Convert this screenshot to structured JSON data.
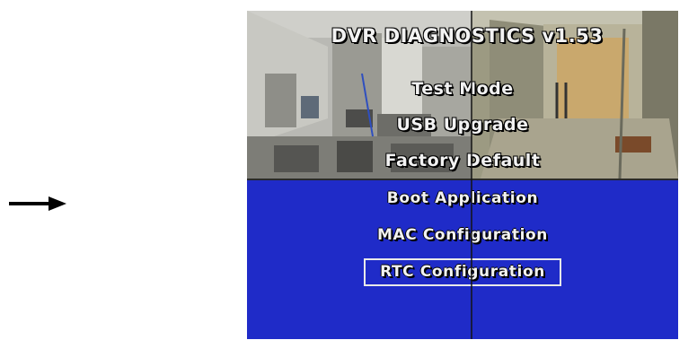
{
  "title": "DVR DIAGNOSTICS v1.53",
  "overlay_menu": [
    {
      "label": "Test Mode"
    },
    {
      "label": "USB Upgrade"
    },
    {
      "label": "Factory Default"
    }
  ],
  "menu": [
    {
      "label": "Boot Application",
      "selected": false
    },
    {
      "label": "MAC Configuration",
      "selected": false
    },
    {
      "label": "RTC Configuration",
      "selected": true
    }
  ],
  "colors": {
    "menu_background": "#1f2bc8",
    "text": "#f2f2f2",
    "selection_border": "#e9e9e9"
  },
  "pointer_icon": "right-arrow-icon"
}
